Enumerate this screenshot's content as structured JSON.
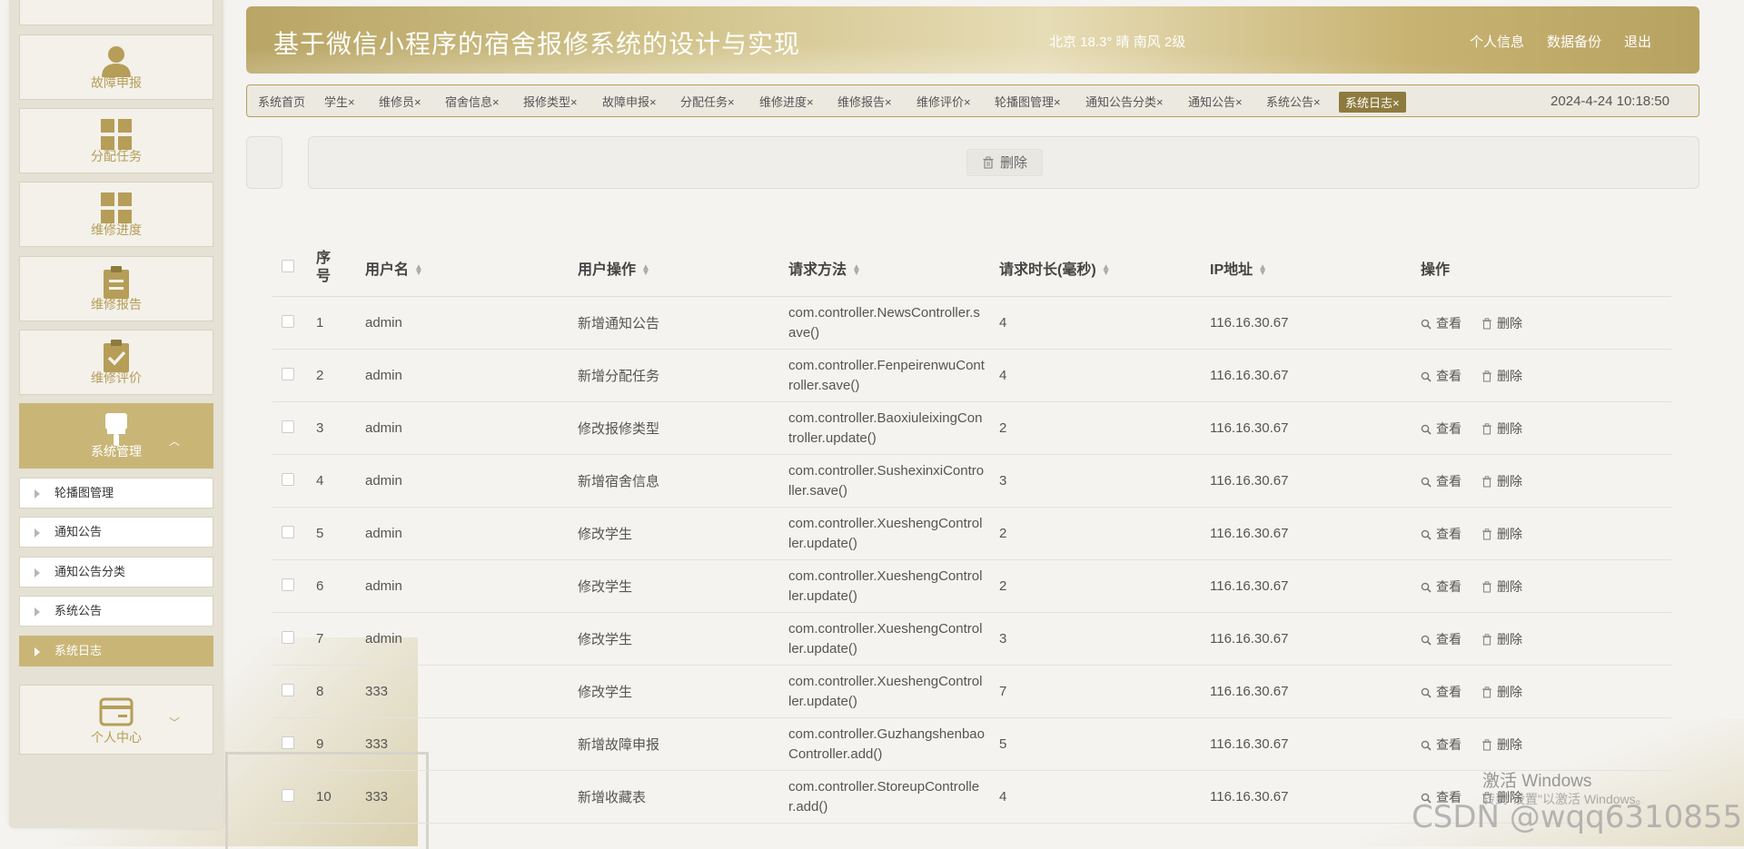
{
  "header": {
    "title": "基于微信小程序的宿舍报修系统的设计与实现",
    "weather": "北京  18.3°  晴  南风  2级",
    "links": [
      "个人信息",
      "数据备份",
      "退出"
    ]
  },
  "sidebar": {
    "menu": [
      {
        "label": "故障申报",
        "icon": "user-icon"
      },
      {
        "label": "分配任务",
        "icon": "grid-icon"
      },
      {
        "label": "维修进度",
        "icon": "grid-icon"
      },
      {
        "label": "维修报告",
        "icon": "clipboard-icon"
      },
      {
        "label": "维修评价",
        "icon": "clipboard-check-icon"
      },
      {
        "label": "系统管理",
        "icon": "brush-icon"
      }
    ],
    "sub_items": [
      "轮播图管理",
      "通知公告",
      "通知公告分类",
      "系统公告",
      "系统日志"
    ],
    "personal": "个人中心"
  },
  "tabs": [
    "系统首页",
    "学生",
    "维修员",
    "宿舍信息",
    "报修类型",
    "故障申报",
    "分配任务",
    "维修进度",
    "维修报告",
    "维修评价",
    "轮播图管理",
    "通知公告分类",
    "通知公告",
    "系统公告",
    "系统日志"
  ],
  "tab_close": "×",
  "active_tab": "系统日志",
  "datetime": "2024-4-24 10:18:50",
  "toolbar": {
    "delete_label": "删除"
  },
  "table": {
    "headers": [
      "序号",
      "用户名",
      "用户操作",
      "请求方法",
      "请求时长(毫秒)",
      "IP地址",
      "操作"
    ],
    "view_label": "查看",
    "delete_label": "删除",
    "rows": [
      {
        "no": "1",
        "user": "admin",
        "action": "新增通知公告",
        "method": "com.controller.NewsController.save()",
        "duration": "4",
        "ip": "116.16.30.67"
      },
      {
        "no": "2",
        "user": "admin",
        "action": "新增分配任务",
        "method": "com.controller.FenpeirenwuController.save()",
        "duration": "4",
        "ip": "116.16.30.67"
      },
      {
        "no": "3",
        "user": "admin",
        "action": "修改报修类型",
        "method": "com.controller.BaoxiuleixingController.update()",
        "duration": "2",
        "ip": "116.16.30.67"
      },
      {
        "no": "4",
        "user": "admin",
        "action": "新增宿舍信息",
        "method": "com.controller.SushexinxiController.save()",
        "duration": "3",
        "ip": "116.16.30.67"
      },
      {
        "no": "5",
        "user": "admin",
        "action": "修改学生",
        "method": "com.controller.XueshengController.update()",
        "duration": "2",
        "ip": "116.16.30.67"
      },
      {
        "no": "6",
        "user": "admin",
        "action": "修改学生",
        "method": "com.controller.XueshengController.update()",
        "duration": "2",
        "ip": "116.16.30.67"
      },
      {
        "no": "7",
        "user": "admin",
        "action": "修改学生",
        "method": "com.controller.XueshengController.update()",
        "duration": "3",
        "ip": "116.16.30.67"
      },
      {
        "no": "8",
        "user": "333",
        "action": "修改学生",
        "method": "com.controller.XueshengController.update()",
        "duration": "7",
        "ip": "116.16.30.67"
      },
      {
        "no": "9",
        "user": "333",
        "action": "新增故障申报",
        "method": "com.controller.GuzhangshenbaoController.add()",
        "duration": "5",
        "ip": "116.16.30.67"
      },
      {
        "no": "10",
        "user": "333",
        "action": "新增收藏表",
        "method": "com.controller.StoreupController.add()",
        "duration": "4",
        "ip": "116.16.30.67"
      }
    ]
  },
  "watermarks": {
    "windows_title": "激活 Windows",
    "windows_sub": "转到\"设置\"以激活 Windows。",
    "csdn": "CSDN @wqq6310855"
  },
  "colors": {
    "accent": "#c9b677",
    "accent_dark": "#8d7b3e",
    "menu_text": "#b69d58"
  }
}
